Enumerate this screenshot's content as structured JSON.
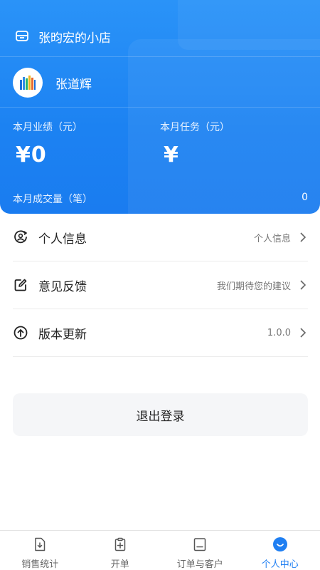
{
  "header": {
    "shop_name": "张昀宏的小店",
    "user_name": "张道辉",
    "monthly_sales_label": "本月业绩（元）",
    "monthly_sales_value": "¥0",
    "monthly_task_label": "本月任务（元）",
    "monthly_task_value": "¥",
    "monthly_volume_label": "本月成交量（笔）",
    "monthly_volume_value": "0"
  },
  "menu": {
    "items": [
      {
        "label": "个人信息",
        "value": "个人信息",
        "icon": "user-info-icon"
      },
      {
        "label": "意见反馈",
        "value": "我们期待您的建议",
        "icon": "edit-icon"
      },
      {
        "label": "版本更新",
        "value": "1.0.0",
        "icon": "upload-icon"
      }
    ]
  },
  "logout_label": "退出登录",
  "tabbar": {
    "active_index": 3,
    "items": [
      {
        "label": "销售统计",
        "icon": "sales-stats-icon"
      },
      {
        "label": "开单",
        "icon": "clipboard-plus-icon"
      },
      {
        "label": "订单与客户",
        "icon": "order-customer-icon"
      },
      {
        "label": "个人中心",
        "icon": "personal-center-icon"
      }
    ]
  },
  "colors": {
    "primary": "#1f7ff2",
    "hero_top": "#2a93f8",
    "background": "#ffffff",
    "logout_bg": "#f5f6f8"
  }
}
